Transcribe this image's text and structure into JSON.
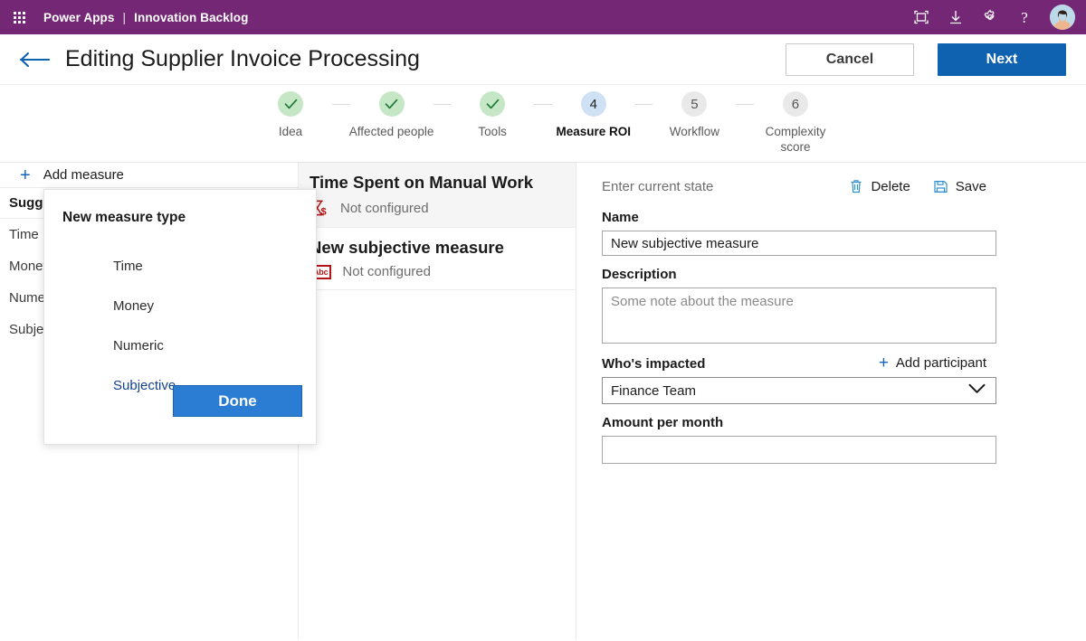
{
  "suite": {
    "waffle_icon": "waffle-grid-icon",
    "brand": "Power Apps",
    "separator": "|",
    "app_name": "Innovation Backlog",
    "icons": [
      {
        "name": "fullscreen-icon",
        "label": "Fullscreen"
      },
      {
        "name": "download-icon",
        "label": "Download"
      },
      {
        "name": "gear-icon",
        "label": "Settings"
      },
      {
        "name": "help-icon",
        "label": "?"
      }
    ],
    "avatar": "user-avatar"
  },
  "command_bar": {
    "back_icon": "back-arrow-icon",
    "title": "Editing Supplier Invoice Processing",
    "cancel_label": "Cancel",
    "next_label": "Next"
  },
  "stepper": {
    "steps": [
      {
        "number": "1",
        "label": "Idea",
        "state": "done",
        "mark": "✓"
      },
      {
        "number": "2",
        "label": "Affected people",
        "state": "done",
        "mark": "✓"
      },
      {
        "number": "3",
        "label": "Tools",
        "state": "done",
        "mark": "✓"
      },
      {
        "number": "4",
        "label": "Measure ROI",
        "state": "current",
        "mark": "4"
      },
      {
        "number": "5",
        "label": "Workflow",
        "state": "todo",
        "mark": "5"
      },
      {
        "number": "6",
        "label": "Complexity score",
        "state": "todo",
        "mark": "6"
      }
    ]
  },
  "left_pane": {
    "add_measure_label": "Add measure",
    "group_header": "Suggested",
    "types": [
      "Time",
      "Money",
      "Numeric",
      "Subjective"
    ]
  },
  "dialog": {
    "title": "New measure type",
    "options": [
      "Time",
      "Money",
      "Numeric",
      "Subjective"
    ],
    "selected_option": "Subjective",
    "done_label": "Done"
  },
  "measures": [
    {
      "name": "Time Spent on Manual Work",
      "status": "Not configured",
      "icon": "hourglass-money-icon",
      "active": true
    },
    {
      "name": "New subjective measure",
      "status": "Not configured",
      "icon": "abc-text-icon",
      "active": false
    }
  ],
  "detail": {
    "state_text": "Enter current state",
    "delete_label": "Delete",
    "delete_icon": "trash-icon",
    "save_label": "Save",
    "save_icon": "save-disk-icon",
    "name_label": "Name",
    "name_value": "New subjective measure",
    "description_label": "Description",
    "description_value": "",
    "description_placeholder": "Some note about the measure",
    "impacted_label": "Who's impacted",
    "add_participant_label": "Add participant",
    "impacted_value": "Finance Team",
    "amount_label": "Amount per month",
    "amount_value": ""
  },
  "colors": {
    "suite_bar": "#742774",
    "primary_button": "#0f62b0",
    "dialog_button": "#2b7cd3",
    "step_done": "#c5e7c5",
    "step_current": "#cfe2f5",
    "step_todo": "#e9e9e9",
    "measure_icon_red": "#b31515",
    "link_blue": "#1565c0"
  }
}
